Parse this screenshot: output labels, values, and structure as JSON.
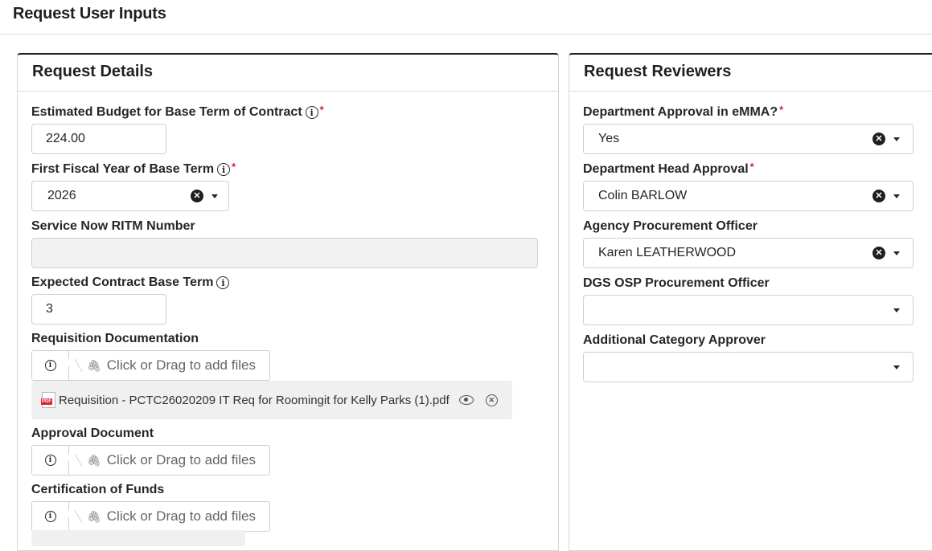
{
  "page": {
    "title": "Request User Inputs"
  },
  "details": {
    "header": "Request Details",
    "budget": {
      "label": "Estimated Budget for Base Term of Contract",
      "value": "224.00"
    },
    "fiscal_year": {
      "label": "First Fiscal Year of Base Term",
      "value": "2026"
    },
    "ritm": {
      "label": "Service Now RITM Number",
      "value": ""
    },
    "base_term": {
      "label": "Expected Contract Base Term",
      "value": "3"
    },
    "requisition": {
      "label": "Requisition Documentation",
      "drop_text": "Click or Drag to add files",
      "file_name": "Requisition - PCTC26020209 IT Req for Roomingit for Kelly Parks (1).pdf"
    },
    "approval_doc": {
      "label": "Approval Document",
      "drop_text": "Click or Drag to add files"
    },
    "cert_funds": {
      "label": "Certification of Funds",
      "drop_text": "Click or Drag to add files"
    }
  },
  "reviewers": {
    "header": "Request Reviewers",
    "emma": {
      "label": "Department Approval in eMMA?",
      "value": "Yes"
    },
    "dept_head": {
      "label": "Department Head Approval",
      "value": "Colin BARLOW"
    },
    "agency_officer": {
      "label": "Agency Procurement Officer",
      "value": "Karen LEATHERWOOD"
    },
    "dgs_officer": {
      "label": "DGS OSP Procurement Officer",
      "value": ""
    },
    "category_approver": {
      "label": "Additional Category Approver",
      "value": ""
    }
  },
  "common": {
    "required_mark": "*",
    "pdf_badge": "PDF"
  },
  "colors": {
    "required": "#d9232d",
    "header_border": "#1f1f1f",
    "disabled_bg": "#f2f2f2"
  }
}
